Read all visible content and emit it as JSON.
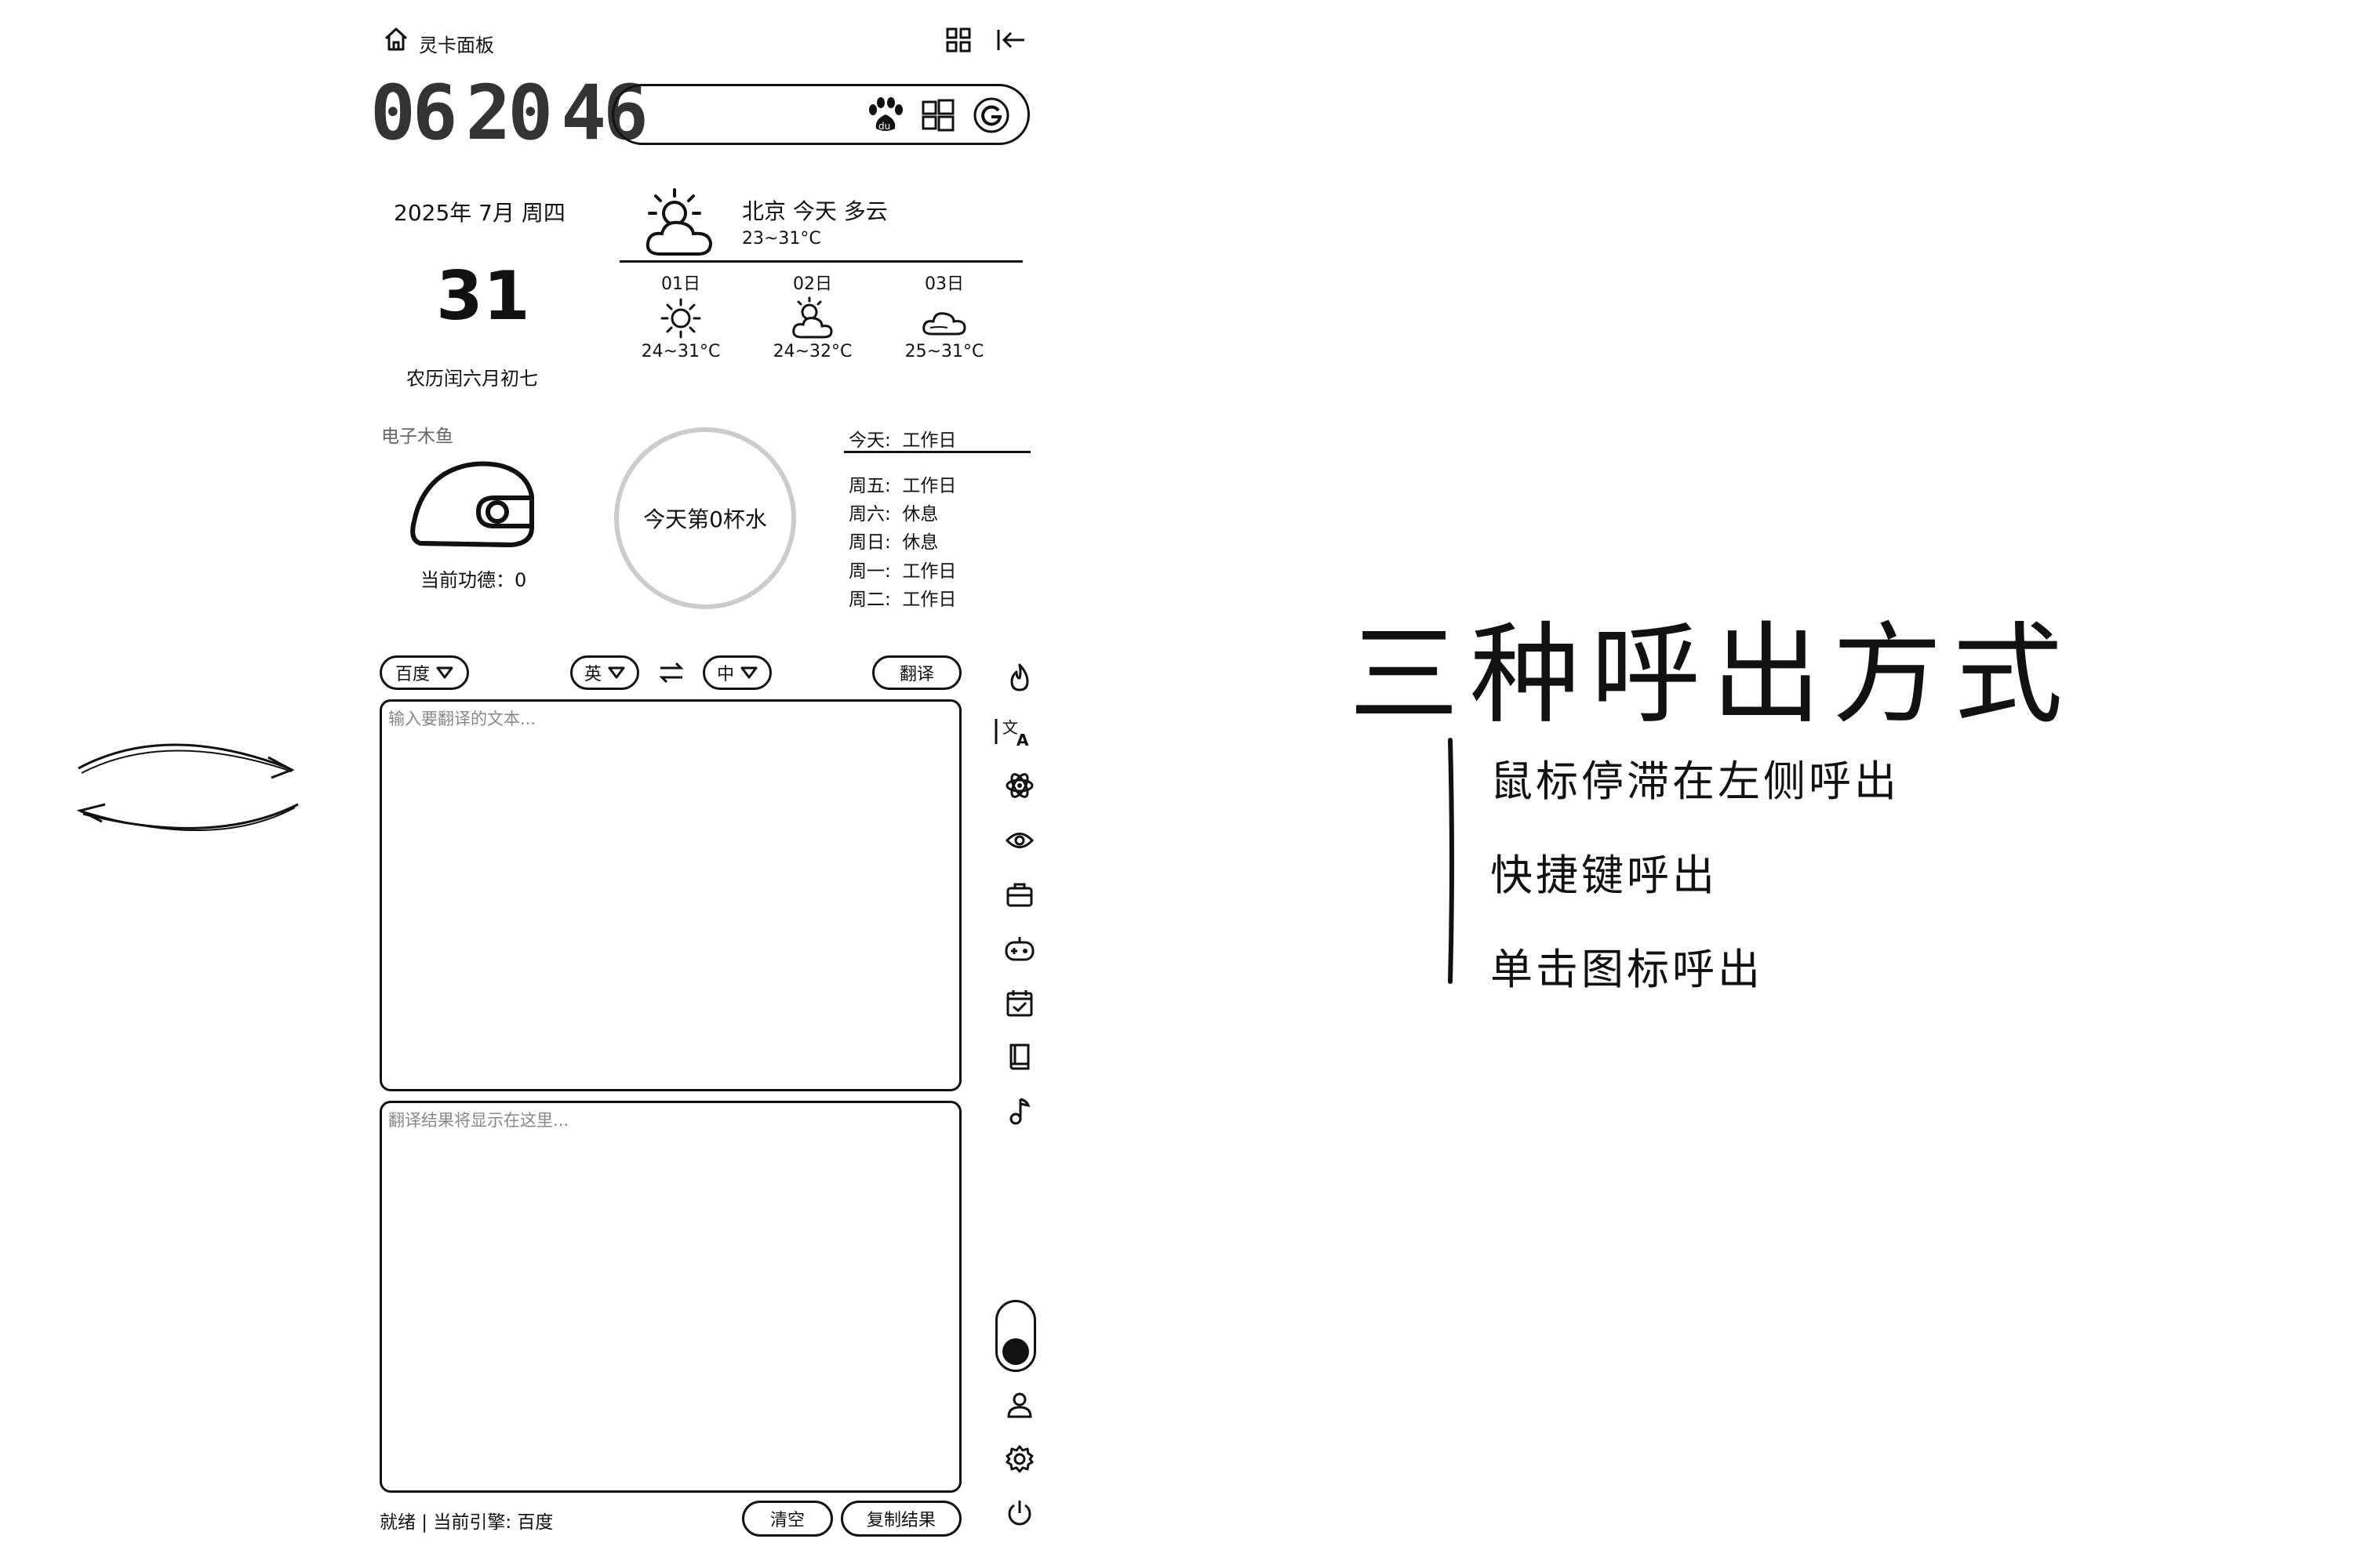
{
  "header": {
    "title": "灵卡面板",
    "home_icon": "home-icon",
    "grid_icon": "grid-icon",
    "collapse_icon": "collapse-left-icon"
  },
  "clock": {
    "hours": "06",
    "minutes": "20",
    "seconds": "46"
  },
  "search": {
    "value": "",
    "engines": [
      "baidu-icon",
      "windows-icon",
      "google-icon"
    ]
  },
  "calendar": {
    "year_month_weekday": "2025年 7月 周四",
    "day": "31",
    "lunar": "农历闰六月初七"
  },
  "weather": {
    "location_text": "北京 今天 多云",
    "temp_range": "23~31°C",
    "forecast": [
      {
        "date": "01日",
        "icon": "sunny-icon",
        "temp": "24~31°C"
      },
      {
        "date": "02日",
        "icon": "partly-cloudy-icon",
        "temp": "24~32°C"
      },
      {
        "date": "03日",
        "icon": "cloudy-icon",
        "temp": "25~31°C"
      }
    ]
  },
  "woodfish": {
    "label": "电子木鱼",
    "merit_text": "当前功德：0"
  },
  "water": {
    "text": "今天第0杯水"
  },
  "workdays": {
    "today": {
      "label": "今天:",
      "status": "工作日"
    },
    "rows": [
      {
        "label": "周五:",
        "status": "工作日"
      },
      {
        "label": "周六:",
        "status": "休息"
      },
      {
        "label": "周日:",
        "status": "休息"
      },
      {
        "label": "周一:",
        "status": "工作日"
      },
      {
        "label": "周二:",
        "status": "工作日"
      }
    ]
  },
  "translator": {
    "engine": "百度",
    "source_lang": "英",
    "target_lang": "中",
    "translate_label": "翻译",
    "input_placeholder": "输入要翻译的文本...",
    "output_placeholder": "翻译结果将显示在这里...",
    "status_text": "就绪 | 当前引擎: 百度",
    "clear_label": "清空",
    "copy_label": "复制结果"
  },
  "sidebar": {
    "icons": [
      "flame-icon",
      "translate-icon",
      "atom-icon",
      "eye-icon",
      "toolbox-icon",
      "gamepad-icon",
      "calendar-check-icon",
      "book-icon",
      "music-note-icon"
    ],
    "bottom_icons": [
      "user-icon",
      "gear-icon",
      "power-icon"
    ]
  },
  "annotation": {
    "headline": "三种呼出方式",
    "items": [
      "鼠标停滞在左侧呼出",
      "快捷键呼出",
      "单击图标呼出"
    ]
  }
}
